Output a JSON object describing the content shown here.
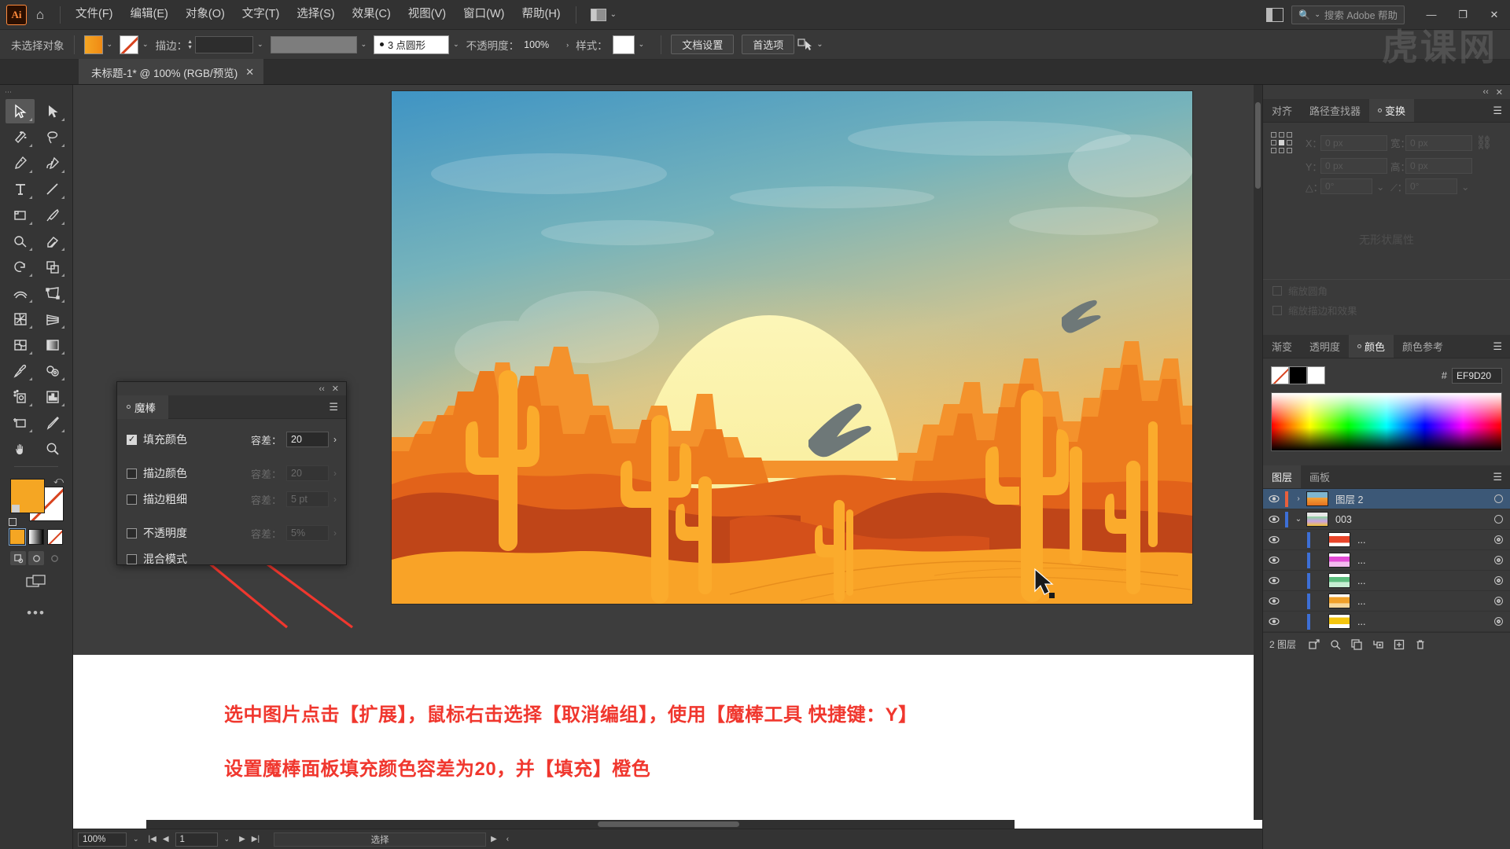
{
  "app": {
    "logo": "Ai",
    "watermark": "虎课网"
  },
  "menubar": {
    "items": [
      {
        "label": "文件(F)",
        "name": "menu-file"
      },
      {
        "label": "编辑(E)",
        "name": "menu-edit"
      },
      {
        "label": "对象(O)",
        "name": "menu-object"
      },
      {
        "label": "文字(T)",
        "name": "menu-type"
      },
      {
        "label": "选择(S)",
        "name": "menu-select"
      },
      {
        "label": "效果(C)",
        "name": "menu-effect"
      },
      {
        "label": "视图(V)",
        "name": "menu-view"
      },
      {
        "label": "窗口(W)",
        "name": "menu-window"
      },
      {
        "label": "帮助(H)",
        "name": "menu-help"
      }
    ],
    "search_placeholder": "搜索 Adobe 帮助",
    "minimize": "—",
    "maximize": "❐",
    "close": "✕"
  },
  "controlbar": {
    "selection_status": "未选择对象",
    "stroke_label": "描边：",
    "stroke_weight": "",
    "profile": "",
    "brush_def": "3 点圆形",
    "opacity_label": "不透明度：",
    "opacity_value": "100%",
    "style_label": "样式：",
    "doc_setup": "文档设置",
    "preferences": "首选项"
  },
  "tabbar": {
    "document_title": "未标题-1* @ 100% (RGB/预览)",
    "close": "✕"
  },
  "toolbar": {
    "tools": [
      "selection-tool",
      "direct-selection-tool",
      "magic-wand-tool",
      "lasso-tool",
      "pen-tool",
      "curvature-tool",
      "type-tool",
      "line-segment-tool",
      "rectangle-tool",
      "paintbrush-tool",
      "shaper-tool",
      "eraser-tool",
      "rotate-tool",
      "scale-tool",
      "width-tool",
      "free-transform-tool",
      "shape-builder-tool",
      "perspective-grid-tool",
      "mesh-tool",
      "gradient-tool",
      "eyedropper-tool",
      "blend-tool",
      "symbol-sprayer-tool",
      "column-graph-tool",
      "artboard-tool",
      "slice-tool",
      "hand-tool",
      "zoom-tool"
    ],
    "fill_color": "#F5A623",
    "stroke_color": "none",
    "more_tools": "•••"
  },
  "magic_wand_panel": {
    "title": "魔棒",
    "rows": [
      {
        "label": "填充颜色",
        "checked": true,
        "tol_label": "容差：",
        "tol_value": "20",
        "enabled": true
      },
      {
        "label": "描边颜色",
        "checked": false,
        "tol_label": "容差：",
        "tol_value": "20",
        "enabled": false
      },
      {
        "label": "描边粗细",
        "checked": false,
        "tol_label": "容差：",
        "tol_value": "5 pt",
        "enabled": false
      },
      {
        "label": "不透明度",
        "checked": false,
        "tol_label": "容差：",
        "tol_value": "5%",
        "enabled": false
      },
      {
        "label": "混合模式",
        "checked": false,
        "tol_label": "",
        "tol_value": "",
        "enabled": false
      }
    ],
    "collapse": "‹‹",
    "close": "✕",
    "menu": "☰"
  },
  "right_panels": {
    "transform": {
      "tabs": [
        {
          "label": "对齐",
          "active": false
        },
        {
          "label": "路径查找器",
          "active": false
        },
        {
          "label": "变换",
          "active": true
        }
      ],
      "x_label": "X：",
      "x_value": "0 px",
      "y_label": "Y：",
      "y_value": "0 px",
      "w_label": "宽：",
      "w_value": "0 px",
      "h_label": "高：",
      "h_value": "0 px",
      "angle_label": "△：",
      "angle_value": "0°",
      "shear_label": "⟋：",
      "shear_value": "0°",
      "empty_text": "无形状属性",
      "check_corners": "缩放圆角",
      "check_strokes": "缩放描边和效果",
      "collapse": "‹‹",
      "close": "✕",
      "menu": "☰"
    },
    "color": {
      "tabs": [
        {
          "label": "渐变",
          "active": false
        },
        {
          "label": "透明度",
          "active": false
        },
        {
          "label": "颜色",
          "active": true
        },
        {
          "label": "颜色参考",
          "active": false
        }
      ],
      "hex_symbol": "#",
      "hex_value": "EF9D20",
      "menu": "☰"
    },
    "layers": {
      "tabs": [
        {
          "label": "图层",
          "active": true
        },
        {
          "label": "画板",
          "active": false
        }
      ],
      "menu": "☰",
      "rows": [
        {
          "name": "图层 2",
          "selected": true,
          "indent": 0,
          "thumb": "artwork",
          "expand": "›"
        },
        {
          "name": "003",
          "selected": false,
          "indent": 0,
          "thumb": "group",
          "expand": "⌄"
        },
        {
          "name": "...",
          "selected": false,
          "indent": 1,
          "thumb": "red",
          "expand": ""
        },
        {
          "name": "...",
          "selected": false,
          "indent": 1,
          "thumb": "magenta",
          "expand": ""
        },
        {
          "name": "...",
          "selected": false,
          "indent": 1,
          "thumb": "green",
          "expand": ""
        },
        {
          "name": "...",
          "selected": false,
          "indent": 1,
          "thumb": "orange",
          "expand": ""
        },
        {
          "name": "...",
          "selected": false,
          "indent": 1,
          "thumb": "yellow",
          "expand": ""
        }
      ],
      "footer_count": "2 图层",
      "footer_buttons": [
        "release-to-layers-icon",
        "locate-object-icon",
        "make-clipping-mask-icon",
        "create-sublayer-icon",
        "create-new-layer-icon",
        "delete-selection-icon"
      ]
    }
  },
  "annotation": {
    "line1": "选中图片点击【扩展】，鼠标右击选择【取消编组】，使用【魔棒工具 快捷键：Y】",
    "line2": "设置魔棒面板填充颜色容差为20，并【填充】橙色",
    "color": "#F0372E"
  },
  "statusbar": {
    "zoom": "100%",
    "page": "1",
    "status": "选择",
    "nav_first": "|◀",
    "nav_prev": "◀",
    "nav_next": "▶",
    "nav_last": "▶|"
  },
  "artwork": {
    "title": "沙漠日落插画",
    "colors": {
      "sky_top": "#3f94c4",
      "sky_mid": "#86b9b6",
      "sky_glow": "#e8c066",
      "sun": "#f8f0a8",
      "mesa_light": "#f59a2e",
      "mesa_dark": "#e0641b",
      "dune_dark": "#c0461a",
      "sand": "#f9a327",
      "cactus": "#fbab2c",
      "bird": "#6e7878"
    }
  }
}
